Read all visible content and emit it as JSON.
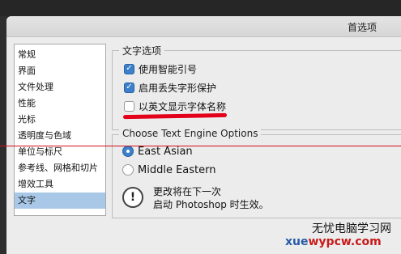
{
  "window": {
    "title": "首选项"
  },
  "sidebar": {
    "items": [
      {
        "label": "常规"
      },
      {
        "label": "界面"
      },
      {
        "label": "文件处理"
      },
      {
        "label": "性能"
      },
      {
        "label": "光标"
      },
      {
        "label": "透明度与色域"
      },
      {
        "label": "单位与标尺"
      },
      {
        "label": "参考线、网格和切片"
      },
      {
        "label": "增效工具"
      },
      {
        "label": "文字"
      }
    ],
    "selected_index": 9
  },
  "text_options": {
    "title": "文字选项",
    "checkboxes": [
      {
        "label": "使用智能引号",
        "checked": true
      },
      {
        "label": "启用丢失字形保护",
        "checked": true
      },
      {
        "label": "以英文显示字体名称",
        "checked": false
      }
    ]
  },
  "engine_options": {
    "title": "Choose Text Engine Options",
    "radios": [
      {
        "label": "East Asian",
        "selected": true
      },
      {
        "label": "Middle Eastern",
        "selected": false
      }
    ],
    "notice": {
      "icon": "exclamation-icon",
      "line1": "更改将在下一次",
      "line2": "启动 Photoshop 时生效。"
    }
  },
  "watermark": {
    "line1": "无忧电脑学习网",
    "line2_blue": "xue",
    "line2_red": "wypcw.com"
  },
  "colors": {
    "accent": "#3d7fc9",
    "selection": "#a9c8e8",
    "annotation_red": "#e3001b"
  }
}
